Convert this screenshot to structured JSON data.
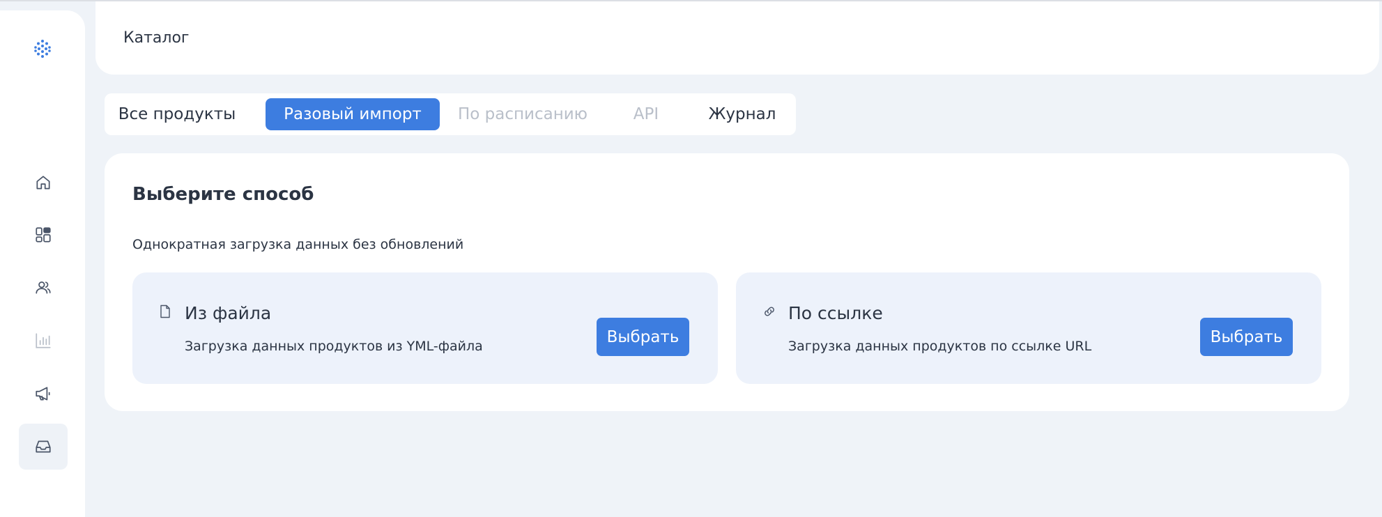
{
  "header": {
    "title": "Каталог"
  },
  "sidebar": {
    "items": [
      {
        "icon": "home-icon",
        "active": false
      },
      {
        "icon": "dashboard-icon",
        "active": false
      },
      {
        "icon": "users-icon",
        "active": false
      },
      {
        "icon": "chart-icon",
        "active": false,
        "muted": true
      },
      {
        "icon": "megaphone-icon",
        "active": false
      },
      {
        "icon": "inbox-icon",
        "active": true
      }
    ]
  },
  "tabs": [
    {
      "label": "Все продукты",
      "state": "normal"
    },
    {
      "label": "Разовый импорт",
      "state": "active"
    },
    {
      "label": "По расписанию",
      "state": "disabled"
    },
    {
      "label": "API",
      "state": "disabled"
    },
    {
      "label": "Журнал",
      "state": "normal"
    }
  ],
  "main": {
    "title": "Выберите способ",
    "subtitle": "Однократная загрузка данных без обновлений",
    "options": [
      {
        "icon": "file-icon",
        "title": "Из файла",
        "description": "Загрузка данных продуктов из YML-файла",
        "button": "Выбрать"
      },
      {
        "icon": "link-icon",
        "title": "По ссылке",
        "description": "Загрузка данных продуктов по ссылке URL",
        "button": "Выбрать"
      }
    ]
  },
  "colors": {
    "accent": "#3d7de0",
    "background": "#eff3f8",
    "card": "#ffffff",
    "option_bg": "#edf2fb",
    "text": "#2b3443",
    "muted": "#b9bfc9"
  }
}
